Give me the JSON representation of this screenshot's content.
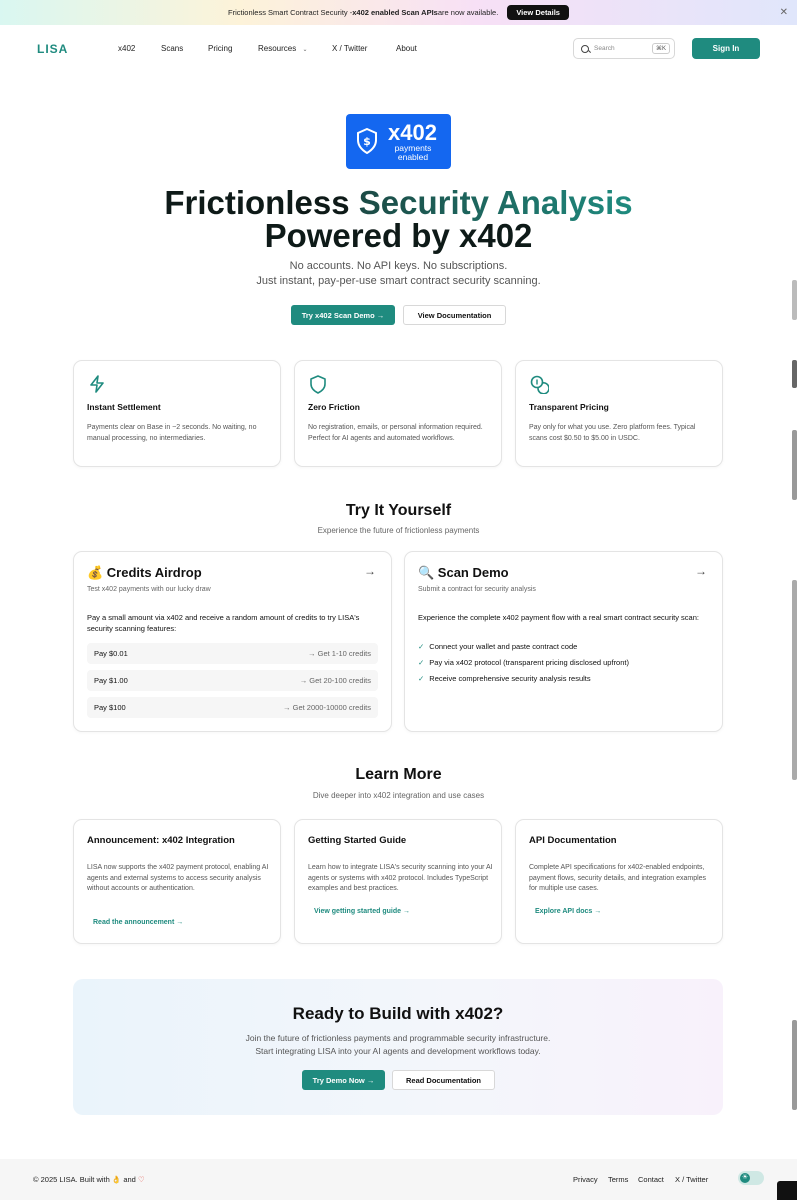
{
  "banner": {
    "text_prefix": "Frictionless Smart Contract Security - ",
    "text_bold": "x402 enabled Scan APIs",
    "text_suffix": " are now available.",
    "button": "View Details",
    "close": "✕"
  },
  "nav": {
    "logo": "LISA",
    "items": [
      "x402",
      "Scans",
      "Pricing",
      "Resources",
      "X / Twitter",
      "About"
    ],
    "search_placeholder": "Search",
    "search_shortcut": "⌘K",
    "sign_in": "Sign In"
  },
  "hero": {
    "badge_big": "x402",
    "badge_small": "payments enabled",
    "title_l1_a": "Frictionless ",
    "title_l1_b": "Security Analysis",
    "title_l2": "Powered by x402",
    "subtitle_1": "No accounts. No API keys. No subscriptions.",
    "subtitle_2": "Just instant, pay-per-use smart contract security scanning.",
    "primary_button": "Try x402 Scan Demo →",
    "secondary_button": "View Documentation"
  },
  "features": [
    {
      "icon": "lightning-icon",
      "title": "Instant Settlement",
      "desc": "Payments clear on Base in ~2 seconds. No waiting, no manual processing, no intermediaries."
    },
    {
      "icon": "shield-icon",
      "title": "Zero Friction",
      "desc": "No registration, emails, or personal information required. Perfect for AI agents and automated workflows."
    },
    {
      "icon": "coins-icon",
      "title": "Transparent Pricing",
      "desc": "Pay only for what you use. Zero platform fees. Typical scans cost $0.50 to $5.00 in USDC."
    }
  ],
  "try_section": {
    "title": "Try It Yourself",
    "subtitle": "Experience the future of frictionless payments",
    "airdrop": {
      "title": "💰 Credits Airdrop",
      "subtitle": "Test x402 payments with our lucky draw",
      "body": "Pay a small amount via x402 and receive a random amount of credits to try LISA's security scanning features:",
      "tiers": [
        {
          "pay": "Pay $0.01",
          "get": "→ Get 1-10 credits"
        },
        {
          "pay": "Pay $1.00",
          "get": "→ Get 20-100 credits"
        },
        {
          "pay": "Pay $100",
          "get": "→ Get 2000-10000 credits"
        }
      ],
      "arrow": "→"
    },
    "scan": {
      "title": "🔍 Scan Demo",
      "subtitle": "Submit a contract for security analysis",
      "body": "Experience the complete x402 payment flow with a real smart contract security scan:",
      "steps": [
        "Connect your wallet and paste contract code",
        "Pay via x402 protocol (transparent pricing disclosed upfront)",
        "Receive comprehensive security analysis results"
      ],
      "check": "✓",
      "arrow": "→"
    }
  },
  "learn_section": {
    "title": "Learn More",
    "subtitle": "Dive deeper into x402 integration and use cases",
    "cards": [
      {
        "title": "Announcement: x402 Integration",
        "desc": "LISA now supports the x402 payment protocol, enabling AI agents and external systems to access security analysis without accounts or authentication.",
        "link": "Read the announcement →"
      },
      {
        "title": "Getting Started Guide",
        "desc": "Learn how to integrate LISA's security scanning into your AI agents or systems with x402 protocol. Includes TypeScript examples and best practices.",
        "link": "View getting started guide →"
      },
      {
        "title": "API Documentation",
        "desc": "Complete API specifications for x402-enabled endpoints, payment flows, security details, and integration examples for multiple use cases.",
        "link": "Explore API docs →"
      }
    ]
  },
  "cta": {
    "title": "Ready to Build with x402?",
    "subtitle_1": "Join the future of frictionless payments and programmable security infrastructure.",
    "subtitle_2": "Start integrating LISA into your AI agents and development workflows today.",
    "primary_button": "Try Demo Now →",
    "secondary_button": "Read Documentation"
  },
  "footer": {
    "copyright": "© 2025 LISA.  Built with ",
    "copyright_and": " and ",
    "thumb": "👌",
    "heart": "♡",
    "links": [
      "Privacy",
      "Terms",
      "Contact",
      "X / Twitter"
    ],
    "theme_icon": "☀"
  },
  "colors": {
    "accent": "#1f8b7f",
    "badge_blue": "#1467f0"
  }
}
